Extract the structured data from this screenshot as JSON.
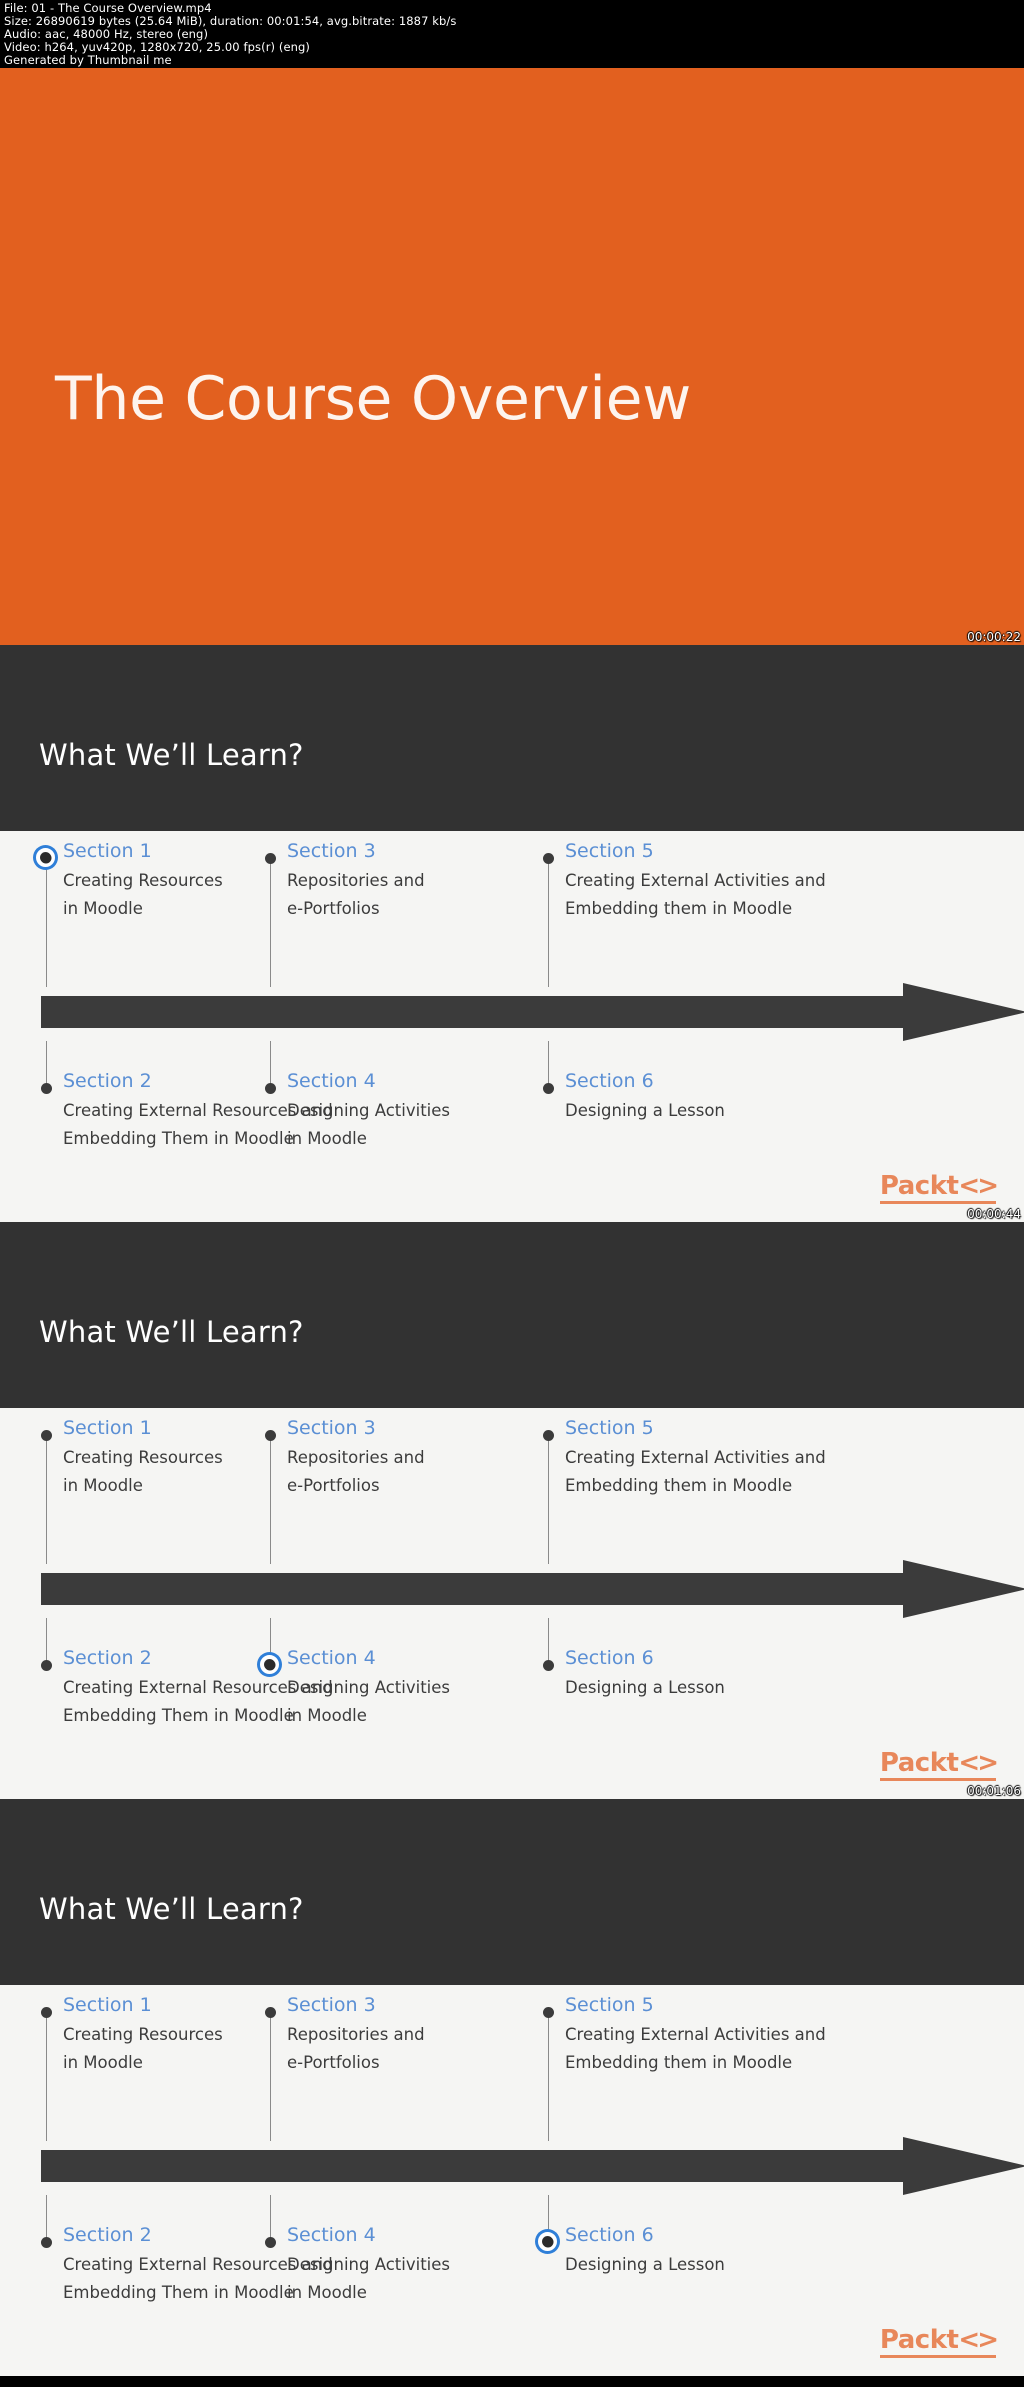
{
  "meta": {
    "line1": "File: 01 - The Course Overview.mp4",
    "line2": "Size: 26890619 bytes (25.64 MiB), duration: 00:01:54, avg.bitrate: 1887 kb/s",
    "line3": "Audio: aac, 48000 Hz, stereo (eng)",
    "line4": "Video: h264, yuv420p, 1280x720, 25.00 fps(r) (eng)",
    "line5": "Generated by Thumbnail me"
  },
  "colors": {
    "orange": "#e2601f",
    "dark_panel": "#323232",
    "slide_bg": "#f5f5f3",
    "section_blue": "#5b8fd4",
    "active_ring": "#2f7fd8",
    "packt_orange": "#e8875a"
  },
  "thumbnails": [
    {
      "kind": "title",
      "title": "The Course Overview",
      "timestamp": "00:00:22"
    },
    {
      "kind": "learn",
      "heading": "What We’ll Learn?",
      "timestamp": "00:00:44",
      "active_section": 1,
      "logo": "Packt",
      "sections": [
        {
          "id": 1,
          "title": "Section 1",
          "desc": "Creating Resources\nin Moodle",
          "row": "top",
          "col": 0
        },
        {
          "id": 3,
          "title": "Section 3",
          "desc": "Repositories and\ne-Portfolios",
          "row": "top",
          "col": 1
        },
        {
          "id": 5,
          "title": "Section 5",
          "desc": "Creating External Activities and\nEmbedding them in Moodle",
          "row": "top",
          "col": 2
        },
        {
          "id": 2,
          "title": "Section 2",
          "desc": "Creating External Resources and\nEmbedding Them in Moodle",
          "row": "bottom",
          "col": 0
        },
        {
          "id": 4,
          "title": "Section 4",
          "desc": "Designing Activities\nin Moodle",
          "row": "bottom",
          "col": 1
        },
        {
          "id": 6,
          "title": "Section 6",
          "desc": "Designing a Lesson",
          "row": "bottom",
          "col": 2
        }
      ]
    },
    {
      "kind": "learn",
      "heading": "What We’ll Learn?",
      "timestamp": "00:01:06",
      "active_section": 4,
      "logo": "Packt",
      "sections": [
        {
          "id": 1,
          "title": "Section 1",
          "desc": "Creating Resources\nin Moodle",
          "row": "top",
          "col": 0
        },
        {
          "id": 3,
          "title": "Section 3",
          "desc": "Repositories and\ne-Portfolios",
          "row": "top",
          "col": 1
        },
        {
          "id": 5,
          "title": "Section 5",
          "desc": "Creating External Activities and\nEmbedding them in Moodle",
          "row": "top",
          "col": 2
        },
        {
          "id": 2,
          "title": "Section 2",
          "desc": "Creating External Resources and\nEmbedding Them in Moodle",
          "row": "bottom",
          "col": 0
        },
        {
          "id": 4,
          "title": "Section 4",
          "desc": "Designing Activities\nin Moodle",
          "row": "bottom",
          "col": 1
        },
        {
          "id": 6,
          "title": "Section 6",
          "desc": "Designing a Lesson",
          "row": "bottom",
          "col": 2
        }
      ]
    },
    {
      "kind": "learn",
      "heading": "What We’ll Learn?",
      "timestamp": "",
      "active_section": 6,
      "logo": "Packt",
      "sections": [
        {
          "id": 1,
          "title": "Section 1",
          "desc": "Creating Resources\nin Moodle",
          "row": "top",
          "col": 0
        },
        {
          "id": 3,
          "title": "Section 3",
          "desc": "Repositories and\ne-Portfolios",
          "row": "top",
          "col": 1
        },
        {
          "id": 5,
          "title": "Section 5",
          "desc": "Creating External Activities and\nEmbedding them in Moodle",
          "row": "top",
          "col": 2
        },
        {
          "id": 2,
          "title": "Section 2",
          "desc": "Creating External Resources and\nEmbedding Them in Moodle",
          "row": "bottom",
          "col": 0
        },
        {
          "id": 4,
          "title": "Section 4",
          "desc": "Designing Activities\nin Moodle",
          "row": "bottom",
          "col": 1
        },
        {
          "id": 6,
          "title": "Section 6",
          "desc": "Designing a Lesson",
          "row": "bottom",
          "col": 2
        }
      ]
    }
  ]
}
